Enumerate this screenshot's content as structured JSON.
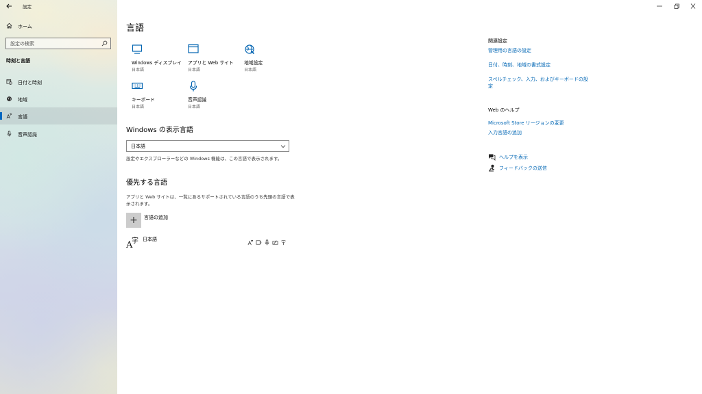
{
  "window": {
    "title": "設定",
    "controls": [
      "minimize",
      "restore",
      "close"
    ]
  },
  "sidebar": {
    "home_label": "ホーム",
    "search_placeholder": "設定の検索",
    "section_title": "時刻と言語",
    "items": [
      {
        "label": "日付と時刻",
        "icon": "calendar-clock-icon",
        "selected": false
      },
      {
        "label": "地域",
        "icon": "globe-icon",
        "selected": false
      },
      {
        "label": "言語",
        "icon": "language-icon",
        "selected": true
      },
      {
        "label": "音声認識",
        "icon": "microphone-icon",
        "selected": false
      }
    ]
  },
  "main": {
    "title": "言語",
    "tiles": [
      {
        "title": "Windows ディスプレイ",
        "sub": "日本語",
        "icon": "monitor-icon"
      },
      {
        "title": "アプリと Web サイト",
        "sub": "日本語",
        "icon": "app-window-icon"
      },
      {
        "title": "地域設定",
        "sub": "日本語",
        "icon": "region-globe-icon"
      },
      {
        "title": "キーボード",
        "sub": "日本語",
        "icon": "keyboard-icon"
      },
      {
        "title": "音声認識",
        "sub": "日本語",
        "icon": "microphone-icon"
      }
    ],
    "display_language": {
      "heading": "Windows の表示言語",
      "selected": "日本語",
      "description": "設定やエクスプローラーなどの Windows 機能は、この言語で表示されます。"
    },
    "preferred": {
      "heading": "優先する言語",
      "description_line1": "アプリと Web サイトは、一覧にあるサポートされている言語のうち先頭の言語で表",
      "description_line2": "示されます。",
      "add_label": "言語の追加",
      "add_symbol": "+",
      "languages": [
        {
          "name": "日本語",
          "glyph": "A字",
          "features": [
            "display-language-icon",
            "text-to-speech-icon",
            "speech-recognition-icon",
            "handwriting-icon",
            "basic-typing-icon"
          ]
        }
      ]
    }
  },
  "related": {
    "heading": "関連設定",
    "links": [
      "管理用の言語の設定",
      "日付、時刻、地域の書式設定",
      "スペルチェック、入力、およびキーボードの設",
      "定"
    ],
    "web_help_heading": "Web のヘルプ",
    "web_links": [
      "Microsoft Store リージョンの変更",
      "入力言語の追加"
    ],
    "help_label": "ヘルプを表示",
    "feedback_label": "フィードバックの送信"
  },
  "colors": {
    "accent": "#0067c0",
    "link": "#0066b4",
    "icon_blue": "#0063b1"
  }
}
